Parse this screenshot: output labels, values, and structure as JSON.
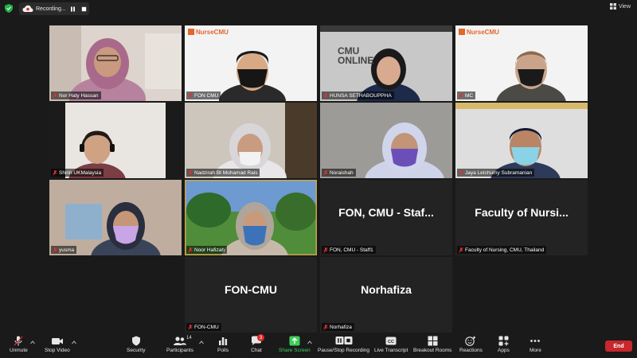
{
  "top_bar": {
    "recording_label": "Recording...",
    "view_label": "View"
  },
  "participants": [
    {
      "name": "Nor Haty Hassan",
      "video": true
    },
    {
      "name": "FON CMU",
      "video": true,
      "background_text": "NurseCMU"
    },
    {
      "name": "HUNSA SETHABOUPPHA",
      "video": true,
      "background_text": "CMU ONLINE"
    },
    {
      "name": "MC",
      "video": true,
      "active_speaker": true,
      "background_text": "NurseCMU"
    },
    {
      "name": "Shirin UKMalaysia",
      "video": true
    },
    {
      "name": "Nadzirah Bt Mohamad Rais",
      "video": true
    },
    {
      "name": "Noraishah",
      "video": true
    },
    {
      "name": "Jaya Letchumy Subramanian",
      "video": true
    },
    {
      "name": "yusma",
      "video": true
    },
    {
      "name": "Noor Hafizah",
      "video": true
    },
    {
      "name": "FON, CMU - Staff1",
      "video": false,
      "display": "FON, CMU - Staf..."
    },
    {
      "name": "Faculty of Nursing, CMU, Thailand",
      "video": false,
      "display": "Faculty of Nursi..."
    },
    {
      "name": "FON-CMU",
      "video": false,
      "display": "FON-CMU"
    },
    {
      "name": "Norhafiza",
      "video": false,
      "display": "Norhafiza"
    }
  ],
  "toolbar": {
    "unmute": "Unmute",
    "stop_video": "Stop Video",
    "security": "Security",
    "participants": "Participants",
    "participants_count": "14",
    "polls": "Polls",
    "chat": "Chat",
    "chat_badge": "3",
    "share_screen": "Share Screen",
    "pause_stop_recording": "Pause/Stop Recording",
    "live_transcript": "Live Transcript",
    "breakout_rooms": "Breakout Rooms",
    "reactions": "Reactions",
    "apps": "Apps",
    "more": "More",
    "end": "End"
  },
  "colors": {
    "active_speaker_border": "#b9e35a",
    "share_green": "#3ecf5a",
    "end_red": "#c7272d",
    "muted_red": "#e03030"
  }
}
